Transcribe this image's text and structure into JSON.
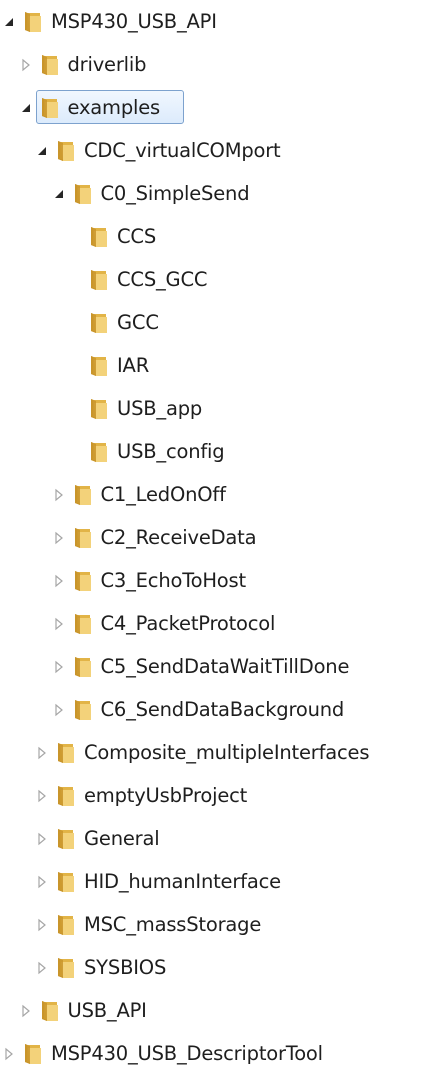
{
  "tree": [
    {
      "label": "MSP430_USB_API",
      "depth": 0,
      "toggle": "expanded"
    },
    {
      "label": "driverlib",
      "depth": 1,
      "toggle": "collapsed"
    },
    {
      "label": "examples",
      "depth": 1,
      "toggle": "expanded",
      "selected": true
    },
    {
      "label": "CDC_virtualCOMport",
      "depth": 2,
      "toggle": "expanded"
    },
    {
      "label": "C0_SimpleSend",
      "depth": 3,
      "toggle": "expanded"
    },
    {
      "label": "CCS",
      "depth": 4,
      "toggle": "none"
    },
    {
      "label": "CCS_GCC",
      "depth": 4,
      "toggle": "none"
    },
    {
      "label": "GCC",
      "depth": 4,
      "toggle": "none"
    },
    {
      "label": "IAR",
      "depth": 4,
      "toggle": "none"
    },
    {
      "label": "USB_app",
      "depth": 4,
      "toggle": "none"
    },
    {
      "label": "USB_config",
      "depth": 4,
      "toggle": "none"
    },
    {
      "label": "C1_LedOnOff",
      "depth": 3,
      "toggle": "collapsed"
    },
    {
      "label": "C2_ReceiveData",
      "depth": 3,
      "toggle": "collapsed"
    },
    {
      "label": "C3_EchoToHost",
      "depth": 3,
      "toggle": "collapsed"
    },
    {
      "label": "C4_PacketProtocol",
      "depth": 3,
      "toggle": "collapsed"
    },
    {
      "label": "C5_SendDataWaitTillDone",
      "depth": 3,
      "toggle": "collapsed"
    },
    {
      "label": "C6_SendDataBackground",
      "depth": 3,
      "toggle": "collapsed"
    },
    {
      "label": "Composite_multipleInterfaces",
      "depth": 2,
      "toggle": "collapsed"
    },
    {
      "label": "emptyUsbProject",
      "depth": 2,
      "toggle": "collapsed"
    },
    {
      "label": "General",
      "depth": 2,
      "toggle": "collapsed"
    },
    {
      "label": "HID_humanInterface",
      "depth": 2,
      "toggle": "collapsed"
    },
    {
      "label": "MSC_massStorage",
      "depth": 2,
      "toggle": "collapsed"
    },
    {
      "label": "SYSBIOS",
      "depth": 2,
      "toggle": "collapsed"
    },
    {
      "label": "USB_API",
      "depth": 1,
      "toggle": "collapsed"
    },
    {
      "label": "MSP430_USB_DescriptorTool",
      "depth": 0,
      "toggle": "collapsed"
    }
  ],
  "icons": {
    "folder": "folder-icon",
    "expanded": "expanded-arrow-icon",
    "collapsed": "collapsed-arrow-icon"
  },
  "colors": {
    "folder_front": "#f3d27a",
    "folder_back": "#e2b447",
    "folder_spine": "#c9952b",
    "selection_border": "#7da2ce",
    "selection_fill": "#dcebfc",
    "arrow_expanded": "#262626",
    "arrow_collapsed": "#a6a6a6"
  }
}
